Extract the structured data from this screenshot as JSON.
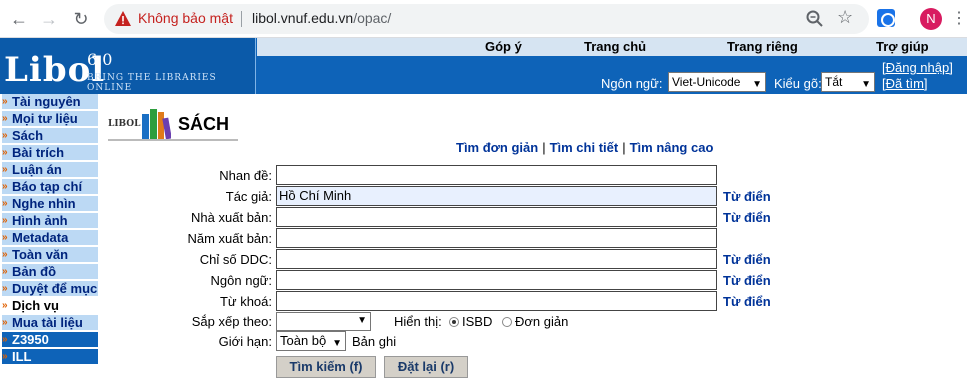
{
  "browser": {
    "warning_text": "Không bảo mật",
    "url_host": "libol.vnuf.edu.vn",
    "url_path": "/opac/",
    "avatar_letter": "N",
    "icons": [
      "back-arrow-icon",
      "forward-arrow-icon",
      "reload-icon",
      "warning-icon",
      "zoom-icon",
      "star-icon",
      "extension-icon",
      "kebab-menu-icon"
    ]
  },
  "header": {
    "logo": "Libol",
    "version": "6.0",
    "tagline": "BRING THE LIBRARIES ONLINE",
    "tabs": [
      "Góp ý",
      "Trang chủ",
      "Trang riêng",
      "Trợ giúp"
    ],
    "language_label": "Ngôn ngữ:",
    "language_value": "Viet-Unicode",
    "input_label": "Kiểu gõ:",
    "input_value": "Tắt",
    "login_link": "[Đăng nhập]",
    "found_link": "[Đã tìm]",
    "colors": {
      "header_bg": "#0e63b8",
      "topbar_bg": "#d6e4f2"
    }
  },
  "sidebar": {
    "items": [
      {
        "label": "Tài nguyên",
        "style": "normal"
      },
      {
        "label": "Mọi tư liệu",
        "style": "normal"
      },
      {
        "label": "Sách",
        "style": "normal"
      },
      {
        "label": "Bài trích",
        "style": "normal"
      },
      {
        "label": "Luận án",
        "style": "normal"
      },
      {
        "label": "Báo tạp chí",
        "style": "normal"
      },
      {
        "label": "Nghe nhìn",
        "style": "normal"
      },
      {
        "label": "Hình ảnh",
        "style": "normal"
      },
      {
        "label": "Metadata",
        "style": "normal"
      },
      {
        "label": "Toàn văn",
        "style": "normal"
      },
      {
        "label": "Bản đồ",
        "style": "normal"
      },
      {
        "label": "Duyệt để mục",
        "style": "normal"
      },
      {
        "label": "Dịch vụ",
        "style": "active"
      },
      {
        "label": "Mua tài liệu",
        "style": "normal"
      },
      {
        "label": "Z3950",
        "style": "dark"
      },
      {
        "label": "ILL",
        "style": "dark"
      }
    ]
  },
  "main": {
    "logo_small": "LIBOL",
    "page_title": "SÁCH",
    "search_links": [
      "Tìm đơn giản",
      "Tìm chi tiết",
      "Tìm nâng cao"
    ],
    "fields": [
      {
        "label": "Nhan đề:",
        "value": "",
        "dict": ""
      },
      {
        "label": "Tác giả:",
        "value": "Hồ Chí Minh",
        "dict": "Từ điển"
      },
      {
        "label": "Nhà xuất bản:",
        "value": "",
        "dict": "Từ điển"
      },
      {
        "label": "Năm xuất bản:",
        "value": "",
        "dict": ""
      },
      {
        "label": "Chỉ số DDC:",
        "value": "",
        "dict": "Từ điển"
      },
      {
        "label": "Ngôn ngữ:",
        "value": "",
        "dict": "Từ điển"
      },
      {
        "label": "Từ khoá:",
        "value": "",
        "dict": "Từ điển"
      }
    ],
    "sort_label": "Sắp xếp theo:",
    "sort_value": "",
    "display_label": "Hiển thị:",
    "display_options": [
      "ISBD",
      "Đơn giản"
    ],
    "display_selected": "ISBD",
    "limit_label": "Giới hạn:",
    "limit_value": "Toàn bộ",
    "limit_unit": "Bản ghi",
    "search_button": "Tìm kiếm (f)",
    "reset_button": "Đặt lại (r)"
  }
}
